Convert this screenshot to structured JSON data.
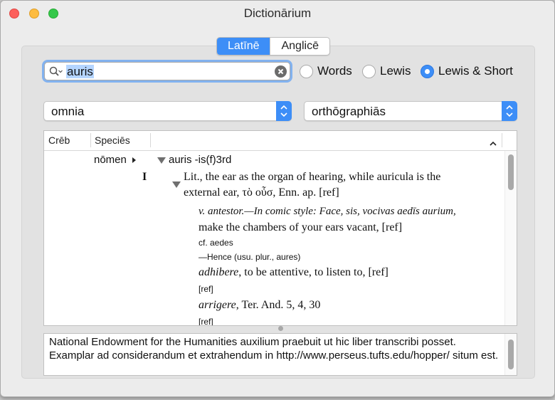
{
  "window": {
    "title": "Dictionārium"
  },
  "tabs": [
    {
      "label": "Latīnē",
      "active": true
    },
    {
      "label": "Anglicē",
      "active": false
    }
  ],
  "search": {
    "value": "auris"
  },
  "dictionaries": [
    {
      "label": "Words",
      "selected": false
    },
    {
      "label": "Lewis",
      "selected": false
    },
    {
      "label": "Lewis & Short",
      "selected": true
    }
  ],
  "filters": {
    "left": "omnia",
    "right": "orthōgraphiās"
  },
  "table": {
    "headers": {
      "frequency": "Crēb",
      "species": "Speciēs"
    },
    "entry": {
      "pos": "nōmen",
      "head": "auris -is(f)3rd",
      "sense_num": "I",
      "sense_line1": "Lit., the ear as the organ of hearing, while auricula is the",
      "sense_line2": "external ear, τὸ οὖσ, Enn. ap. [ref]",
      "l1": "v. antestor.—In comic style: Face, sis, vocivas aedīs aurium,",
      "l2": "make the chambers of your ears vacant, [ref]",
      "l3": "cf. aedes",
      "l4": "—Hence (usu. plur., aures)",
      "l5a": "adhibere",
      "l5b": ", to be attentive, to listen to, [ref]",
      "l6": "[ref]",
      "l7a": "arrigere",
      "l7b": ", Ter. And. 5, 4, 30",
      "l8": "[ref]"
    }
  },
  "info": {
    "text": "National Endowment for the Humanities auxilium praebuit ut hic liber transcribi posset. Examplar ad considerandum et extrahendum in http://www.perseus.tufts.edu/hopper/ situm est."
  },
  "colors": {
    "accent": "#3d8ef7",
    "focus_ring": "#82b2ef",
    "selection": "#b5d5ff"
  }
}
